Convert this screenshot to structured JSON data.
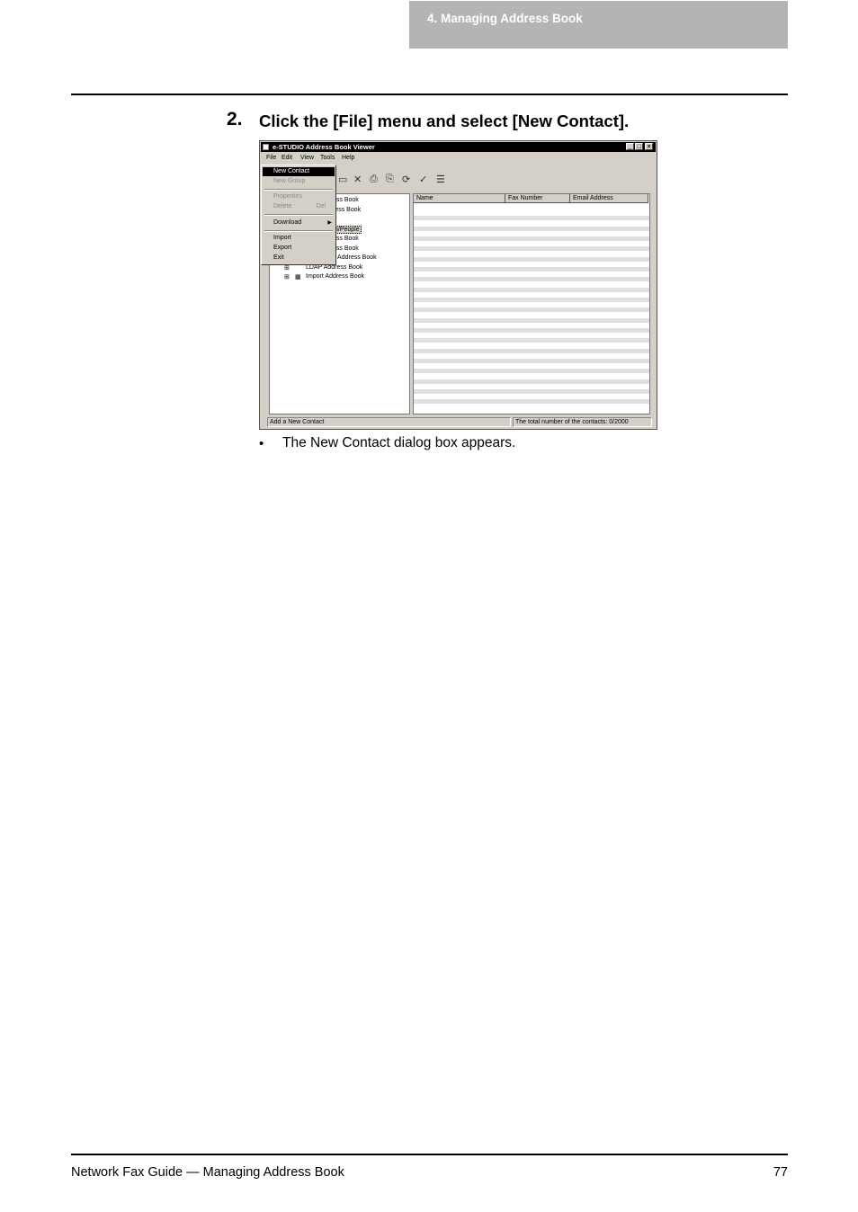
{
  "header": {
    "section": "4. Managing Address Book"
  },
  "step": {
    "number": "2.",
    "instruction": "Click the [File] menu and select [New Contact]."
  },
  "screenshot": {
    "window_title": "e-STUDIO Address Book Viewer",
    "title_buttons": [
      "_",
      "□",
      "×"
    ],
    "menubar": [
      "File",
      "Edit",
      "View",
      "Tools",
      "Help"
    ],
    "file_menu": {
      "new_contact": "New Contact",
      "new_group": "New Group",
      "properties": "Properties",
      "delete": "Delete",
      "delete_key": "Del",
      "download": "Download",
      "import": "Import",
      "export": "Export",
      "exit": "Exit"
    },
    "tree_partial": {
      "n1": "ess Book",
      "n2": "ress Book",
      "n3": "n/People",
      "n4": "ess Book",
      "n5": "ess Book",
      "n6": "s Address Book",
      "n7": "LDAP Address Book",
      "n8": "Import Address Book"
    },
    "columns": [
      "Name",
      "Fax Number",
      "Email Address"
    ],
    "status_left": "Add a New Contact",
    "status_right": "The total number of the contacts: 0/2000"
  },
  "note": "The New Contact dialog box appears.",
  "footer": {
    "title": "Network Fax Guide — Managing Address Book",
    "page": "77"
  }
}
